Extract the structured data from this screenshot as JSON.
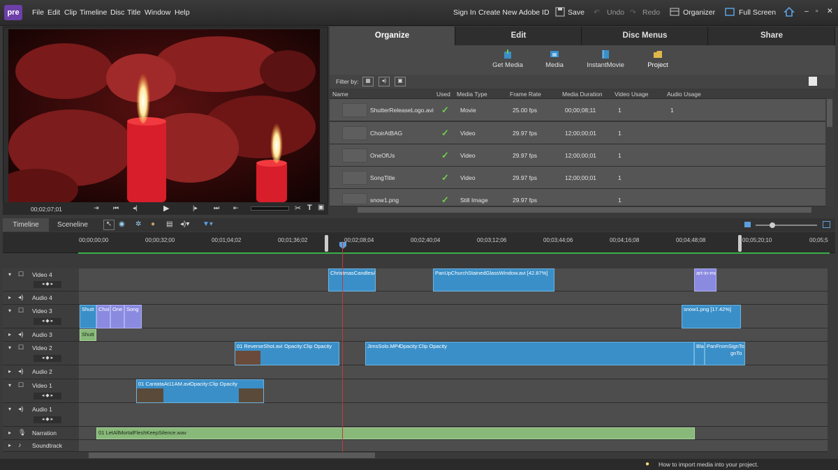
{
  "app": {
    "logo_text": "pre"
  },
  "menu": [
    "File",
    "Edit",
    "Clip",
    "Timeline",
    "Disc",
    "Title",
    "Window",
    "Help"
  ],
  "top": {
    "sign_in": "Sign In",
    "create_id": "Create New Adobe ID",
    "save": "Save",
    "undo": "Undo",
    "redo": "Redo",
    "organizer": "Organizer",
    "full_screen": "Full Screen"
  },
  "monitor": {
    "timecode": "00;02;07;01"
  },
  "tabs": [
    "Organize",
    "Edit",
    "Disc Menus",
    "Share"
  ],
  "subtabs": [
    "Get Media",
    "Media",
    "InstantMovie",
    "Project"
  ],
  "filter": {
    "label": "Filter by:"
  },
  "table": {
    "columns": [
      "Name",
      "Used",
      "Media Type",
      "Frame Rate",
      "Media Duration",
      "Video Usage",
      "Audio Usage"
    ],
    "rows": [
      {
        "name": "ShutterReleaseLogo.avi",
        "type": "Movie",
        "rate": "25.00 fps",
        "duration": "00;00;08;11",
        "video": "1",
        "audio": "1"
      },
      {
        "name": "ChoirAtBAG",
        "type": "Video",
        "rate": "29.97 fps",
        "duration": "12;00;00;01",
        "video": "1",
        "audio": ""
      },
      {
        "name": "OneOfUs",
        "type": "Video",
        "rate": "29.97 fps",
        "duration": "12;00;00;01",
        "video": "1",
        "audio": ""
      },
      {
        "name": "SongTitle",
        "type": "Video",
        "rate": "29.97 fps",
        "duration": "12;00;00;01",
        "video": "1",
        "audio": ""
      },
      {
        "name": "snow1.png",
        "type": "Still Image",
        "rate": "29.97 fps",
        "duration": "",
        "video": "1",
        "audio": ""
      }
    ]
  },
  "timeline": {
    "tabs": [
      "Timeline",
      "Sceneline"
    ],
    "ticks": [
      "00;00;00;00",
      "00;00;32;00",
      "00;01;04;02",
      "00;01;36;02",
      "00;02;08;04",
      "00;02;40;04",
      "00;03;12;06",
      "00;03;44;06",
      "00;04;16;08",
      "00;04;48;08",
      "00;05;20;10",
      "00;05;5"
    ],
    "tracks": [
      "Video 4",
      "Audio 4",
      "Video 3",
      "Audio 3",
      "Video 2",
      "Audio 2",
      "Video 1",
      "Audio 1",
      "Narration",
      "Soundtrack"
    ],
    "clips": {
      "v4a": "ChristmasCandlesA",
      "v4b": "PanUpChurchStainedGlassWindow.avi [42.87%]",
      "v4c": "art-in-motion_cr",
      "v3a": "Shutt",
      "v3b": "Choi",
      "v3c": "One",
      "v3d": "Song",
      "v3e": "snow1.png [17.42%]",
      "a3a": "Shutt",
      "v2a": "01 ReverseShot.avi",
      "v2a_op": "Opacity:Clip Opacity",
      "v2b": "JimsSolo.MP4",
      "v2b_op": "Opacity:Clip Opacity",
      "v2c": "Bla",
      "v2d": "PanFromSignTo",
      "v2d2": "gnTo",
      "v1a": "01 CantataAt11AM.avi",
      "v1a_op": "Opacity:Clip Opacity",
      "nar": "01 LetAllMortalFleshKeepSilence.wav"
    }
  },
  "status": {
    "tip": "How to import media into your project."
  }
}
